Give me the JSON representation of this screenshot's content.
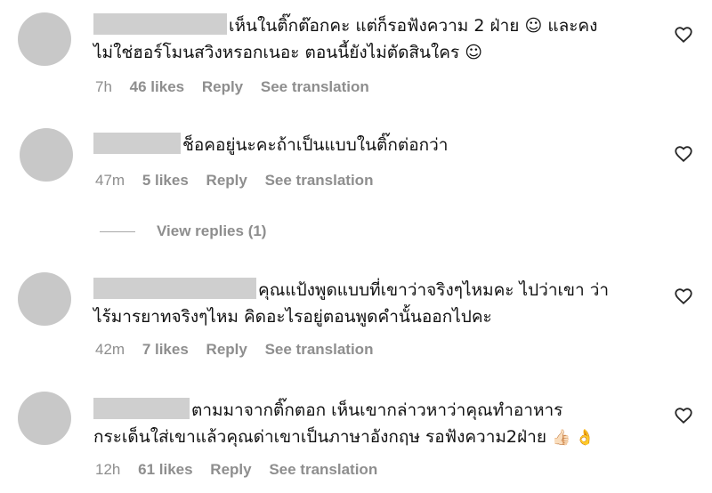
{
  "comments": [
    {
      "line1": "เห็นในติ๊กต๊อกคะ แต่ก็รอฟังความ 2 ฝ่าย ☺ และคง",
      "line2": "ไม่ใช่ฮอร์โมนสวิงหรอกเนอะ ตอนนี้ยังไม่ตัดสินใคร ☺",
      "time": "7h",
      "likes": "46 likes",
      "reply": "Reply",
      "translate": "See translation"
    },
    {
      "line1": "ช็อคอยู่นะคะถ้าเป็นแบบในติ๊กต่อกว่า",
      "time": "47m",
      "likes": "5 likes",
      "reply": "Reply",
      "translate": "See translation"
    },
    {
      "line1": "คุณแป้งพูดแบบที่เขาว่าจริงๆไหมคะ ไปว่าเขา ว่า",
      "line2": "ไร้มารยาทจริงๆไหม คิดอะไรอยู่ตอนพูดคำนั้นออกไปคะ",
      "time": "42m",
      "likes": "7 likes",
      "reply": "Reply",
      "translate": "See translation"
    },
    {
      "line1": "ตามมาจากติ๊กตอก เห็นเขากล่าวหาว่าคุณทำอาหาร",
      "line2": "กระเด็นใส่เขาแล้วคุณด่าเขาเป็นภาษาอังกฤษ รอฟังความ2ฝ่าย",
      "emoji": "👍🏻 👌",
      "time": "12h",
      "likes": "61 likes",
      "reply": "Reply",
      "translate": "See translation"
    }
  ],
  "view_replies": "View replies (1)",
  "icons": {
    "like": "heart-outline-icon"
  }
}
